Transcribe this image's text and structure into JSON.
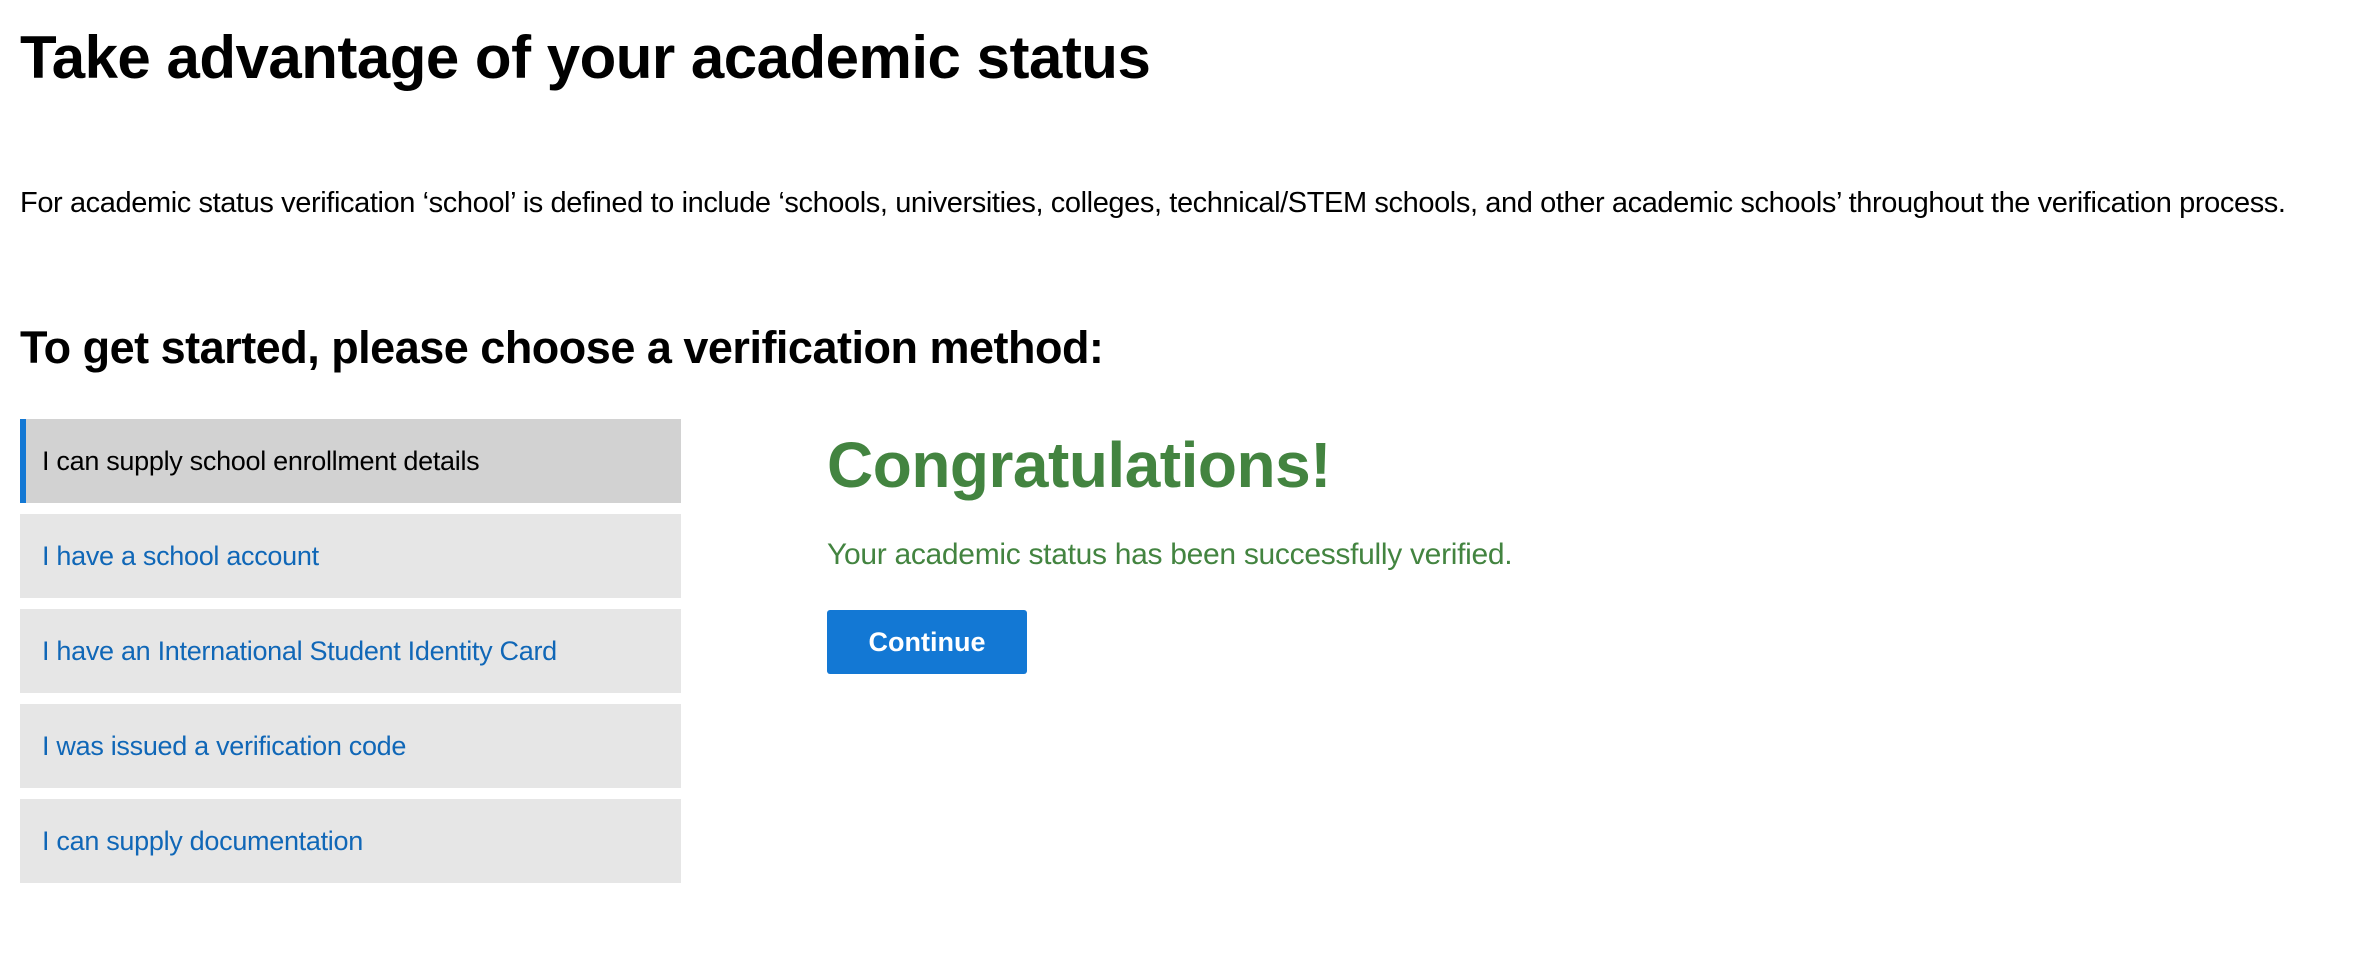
{
  "page": {
    "title": "Take advantage of your academic status",
    "intro": "For academic status verification ‘school’ is defined to include ‘schools, universities, colleges, technical/STEM schools, and other academic schools’ throughout the verification process.",
    "subtitle": "To get started, please choose a verification method:"
  },
  "methods": [
    {
      "label": "I can supply school enrollment details",
      "selected": true
    },
    {
      "label": "I have a school account",
      "selected": false
    },
    {
      "label": "I have an International Student Identity Card",
      "selected": false
    },
    {
      "label": "I was issued a verification code",
      "selected": false
    },
    {
      "label": "I can supply documentation",
      "selected": false
    }
  ],
  "result": {
    "heading": "Congratulations!",
    "message": "Your academic status has been successfully verified.",
    "continue_label": "Continue"
  },
  "colors": {
    "accent": "#1378d4",
    "success": "#438440",
    "link": "#1067b7"
  }
}
